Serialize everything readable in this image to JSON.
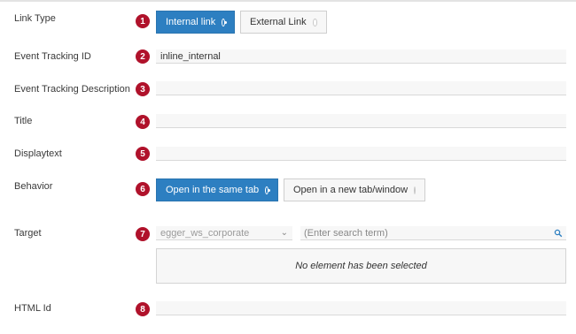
{
  "colors": {
    "accent": "#2d7fc1",
    "badge": "#b0122b"
  },
  "rows": {
    "link_type": {
      "label": "Link Type",
      "badge": "1"
    },
    "event_tracking_id": {
      "label": "Event Tracking ID",
      "badge": "2",
      "value": "inline_internal"
    },
    "event_tracking_description": {
      "label": "Event Tracking Description",
      "badge": "3",
      "value": ""
    },
    "title": {
      "label": "Title",
      "badge": "4",
      "value": ""
    },
    "displaytext": {
      "label": "Displaytext",
      "badge": "5",
      "value": ""
    },
    "behavior": {
      "label": "Behavior",
      "badge": "6"
    },
    "target": {
      "label": "Target",
      "badge": "7"
    },
    "html_id": {
      "label": "HTML Id",
      "badge": "8",
      "value": ""
    }
  },
  "link_type_options": [
    {
      "label": "Internal link",
      "selected": true
    },
    {
      "label": "External Link",
      "selected": false
    }
  ],
  "behavior_options": [
    {
      "label": "Open in the same tab",
      "selected": true
    },
    {
      "label": "Open in a new tab/window",
      "selected": false
    }
  ],
  "target": {
    "select_value": "egger_ws_corporate",
    "search_placeholder": "(Enter search term)",
    "empty_message": "No element has been selected",
    "select_icon": "chevron-down-icon",
    "search_icon": "search-icon"
  }
}
